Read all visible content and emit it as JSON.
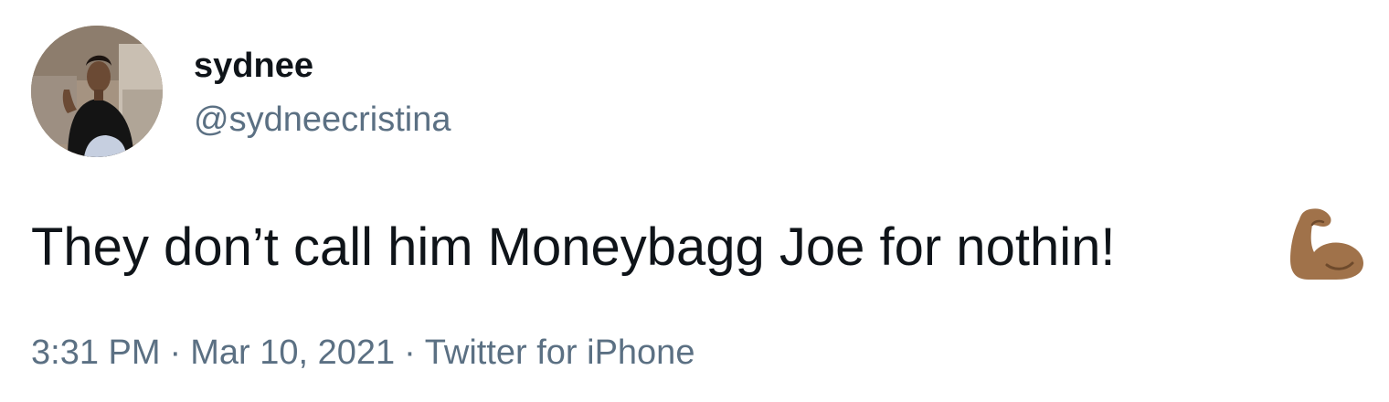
{
  "user": {
    "display_name": "sydnee",
    "handle": "@sydneecristina",
    "avatar_icon": "profile-photo"
  },
  "tweet": {
    "text": "They don’t call him Moneybagg Joe for nothin!",
    "emoji_icon": "flexed-biceps-medium-dark-skin-tone",
    "emoji_color": "#a0724a"
  },
  "meta": {
    "time": "3:31 PM",
    "separator": "·",
    "date": "Mar 10, 2021",
    "source": "Twitter for iPhone"
  },
  "colors": {
    "primary_text": "#0f1419",
    "secondary_text": "#5b7083",
    "background": "#ffffff"
  }
}
